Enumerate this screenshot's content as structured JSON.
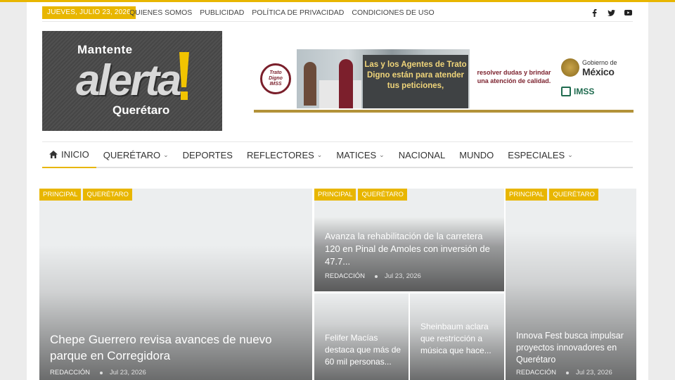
{
  "topbar": {
    "date": "JUEVES, JULIO 23, 2026",
    "links": [
      "QUIENES SOMOS",
      "PUBLICIDAD",
      "POLÍTICA DE PRIVACIDAD",
      "CONDICIONES DE USO"
    ],
    "social": [
      "facebook-icon",
      "twitter-icon",
      "youtube-icon"
    ]
  },
  "logo": {
    "line1": "Mantente",
    "line2": "alerta",
    "line3": "Querétaro"
  },
  "banner": {
    "seal_text": "Trato Digno IMSS",
    "slogan": "Las y los Agentes de Trato Digno están para atender tus peticiones,",
    "middle": "resolver dudas y brindar una atención de calidad.",
    "gob_line1": "Gobierno de",
    "gob_line2": "México",
    "imss": "IMSS"
  },
  "nav": {
    "items": [
      {
        "label": "INICIO",
        "dropdown": false,
        "active": true
      },
      {
        "label": "QUERÉTARO",
        "dropdown": true
      },
      {
        "label": "DEPORTES",
        "dropdown": false
      },
      {
        "label": "REFLECTORES",
        "dropdown": true
      },
      {
        "label": "MATICES",
        "dropdown": true
      },
      {
        "label": "NACIONAL",
        "dropdown": false
      },
      {
        "label": "MUNDO",
        "dropdown": false
      },
      {
        "label": "ESPECIALES",
        "dropdown": true
      }
    ]
  },
  "articles": {
    "main": {
      "cats": [
        "PRINCIPAL",
        "QUERÉTARO"
      ],
      "title": "Chepe Guerrero revisa avances de nuevo parque en Corregidora",
      "author": "REDACCIÓN",
      "date": "Jul 23, 2026"
    },
    "top_middle": {
      "cats": [
        "PRINCIPAL",
        "QUERÉTARO"
      ],
      "title": "Avanza la rehabilitación de la carretera 120 en Pinal de Amoles con inversión de 47.7...",
      "author": "REDACCIÓN",
      "date": "Jul 23, 2026"
    },
    "small_left": {
      "title": "Felifer Macías destaca que más de 60 mil personas..."
    },
    "small_right": {
      "title": "Sheinbaum aclara que restricción a música que hace..."
    },
    "right": {
      "cats": [
        "PRINCIPAL",
        "QUERÉTARO"
      ],
      "title": "Innova Fest busca impulsar proyectos innovadores en Querétaro",
      "author": "REDACCIÓN",
      "date": "Jul 23, 2026"
    }
  }
}
